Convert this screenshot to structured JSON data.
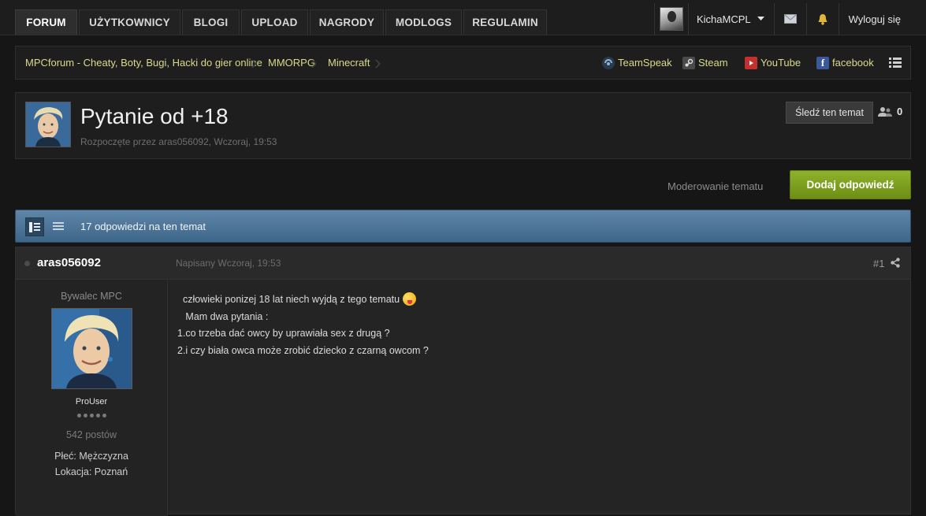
{
  "nav": {
    "tabs": [
      {
        "label": "FORUM",
        "active": true
      },
      {
        "label": "UŻYTKOWNICY",
        "active": false
      },
      {
        "label": "BLOGI",
        "active": false
      },
      {
        "label": "UPLOAD",
        "active": false
      },
      {
        "label": "NAGRODY",
        "active": false
      },
      {
        "label": "MODLOGS",
        "active": false
      },
      {
        "label": "REGULAMIN",
        "active": false
      }
    ],
    "user": {
      "name": "KichaMCPL",
      "logout_label": "Wyloguj się"
    }
  },
  "breadcrumb": {
    "items": [
      "MPCforum - Cheaty, Boty, Bugi, Hacki do gier online",
      "MMORPG",
      "Minecraft"
    ]
  },
  "social": {
    "links": [
      {
        "label": "TeamSpeak",
        "icon": "teamspeak-icon"
      },
      {
        "label": "Steam",
        "icon": "steam-icon"
      },
      {
        "label": "YouTube",
        "icon": "youtube-icon"
      },
      {
        "label": "facebook",
        "icon": "facebook-icon"
      }
    ]
  },
  "topic": {
    "title": "Pytanie od +18",
    "meta": "Rozpoczęte przez aras056092, Wczoraj, 19:53",
    "follow_label": "Śledź ten temat",
    "followers": "0"
  },
  "actions": {
    "moderate_label": "Moderowanie tematu",
    "reply_label": "Dodaj odpowiedź"
  },
  "replies": {
    "count_label": "17 odpowiedzi na ten temat"
  },
  "post": {
    "author": "aras056092",
    "posted": "Napisany Wczoraj, 19:53",
    "number": "#1",
    "rank": "Bywalec MPC",
    "group": "ProUser",
    "postcount": "542 postów",
    "gender": "Płeć: Mężczyzna",
    "location": "Lokacja: Poznań",
    "lines": [
      "  człowieki ponizej 18 lat niech wyjdą z tego tematu",
      "   Mam dwa pytania :",
      "1.co trzeba dać owcy by uprawiała sex z drugą ?",
      "2.i czy biała owca może zrobić dziecko z czarną owcom ?"
    ]
  },
  "colors": {
    "reply_button": "#7ba21f",
    "replies_bar": "#4e769a",
    "link": "#d9d98c"
  }
}
